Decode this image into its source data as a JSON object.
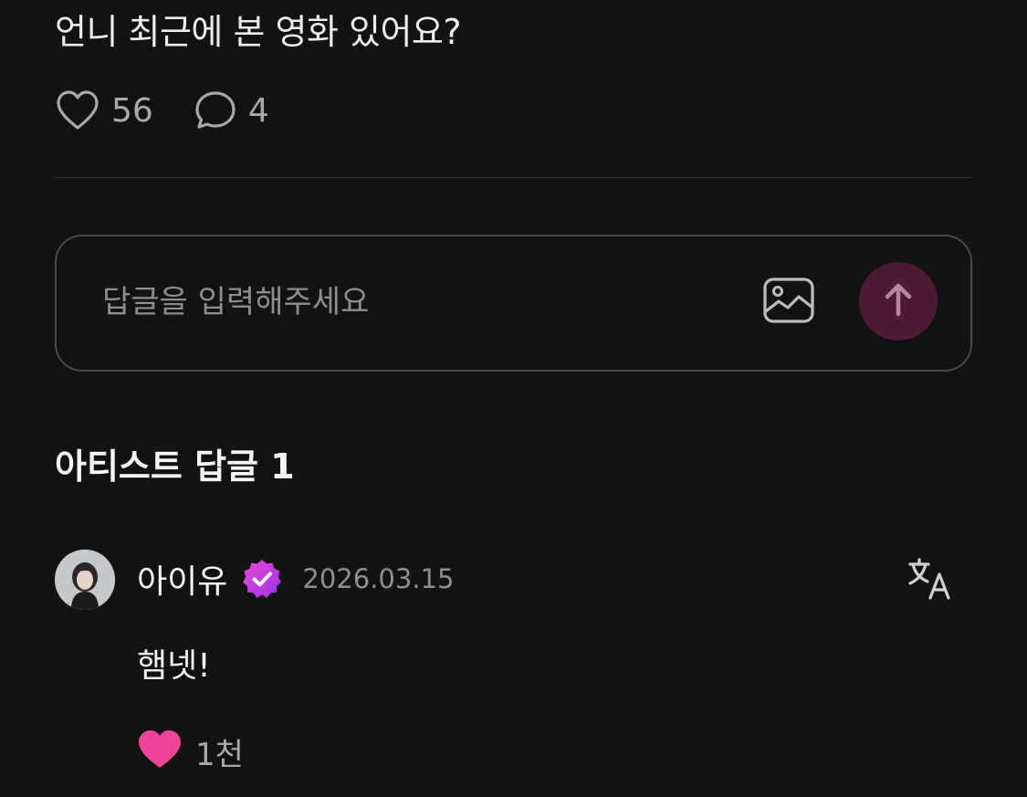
{
  "post": {
    "text": "언니 최근에 본 영화 있어요?",
    "like_count": "56",
    "comment_count": "4"
  },
  "reply": {
    "placeholder": "답글을 입력해주세요",
    "send_accent": "#4a1b33"
  },
  "artist_replies": {
    "title": "아티스트 답글 1",
    "items": [
      {
        "author": "아이유",
        "verified": true,
        "badge_color": "#c23ee0",
        "date": "2026.03.15",
        "text": "햄넷!",
        "like_count": "1천",
        "like_color": "#f0449a"
      }
    ]
  },
  "icons": {
    "like": "heart-outline-icon",
    "comment": "chat-bubble-icon",
    "image": "image-icon",
    "send": "arrow-up-icon",
    "verified": "verified-badge-icon",
    "translate": "translate-icon",
    "liked": "heart-filled-icon"
  }
}
